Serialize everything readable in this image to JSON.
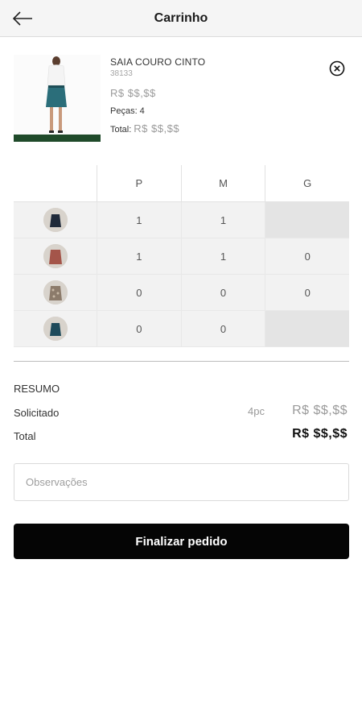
{
  "header": {
    "title": "Carrinho",
    "back_icon": "arrow-left-icon"
  },
  "product": {
    "name": "SAIA COURO CINTO",
    "code": "38133",
    "price": "R$ $$,$$",
    "pieces_label": "Peças: 4",
    "total_label": "Total:",
    "total_value": "R$ $$,$$",
    "remove_icon": "close-circle-icon"
  },
  "grid": {
    "sizes": [
      "P",
      "M",
      "G"
    ],
    "rows": [
      {
        "color": "navy",
        "swatch_hex": "#1f2a3a",
        "values": [
          "1",
          "1",
          ""
        ],
        "disabled": [
          false,
          false,
          true
        ]
      },
      {
        "color": "brick",
        "swatch_hex": "#a4554a",
        "values": [
          "1",
          "1",
          "0"
        ],
        "disabled": [
          false,
          false,
          false
        ]
      },
      {
        "color": "print",
        "swatch_hex": "#8c7b6b",
        "values": [
          "0",
          "0",
          "0"
        ],
        "disabled": [
          false,
          false,
          false
        ]
      },
      {
        "color": "teal",
        "swatch_hex": "#1e4a5a",
        "values": [
          "0",
          "0",
          ""
        ],
        "disabled": [
          false,
          false,
          true
        ]
      }
    ]
  },
  "summary": {
    "title": "RESUMO",
    "requested_label": "Solicitado",
    "requested_qty": "4pc",
    "requested_value": "R$ $$,$$",
    "total_label": "Total",
    "total_value": "R$ $$,$$"
  },
  "notes": {
    "placeholder": "Observações"
  },
  "actions": {
    "finish_label": "Finalizar pedido"
  },
  "colors": {
    "button_bg": "#050505",
    "cell_bg": "#f2f2f2",
    "disabled_cell_bg": "#e4e4e4"
  }
}
